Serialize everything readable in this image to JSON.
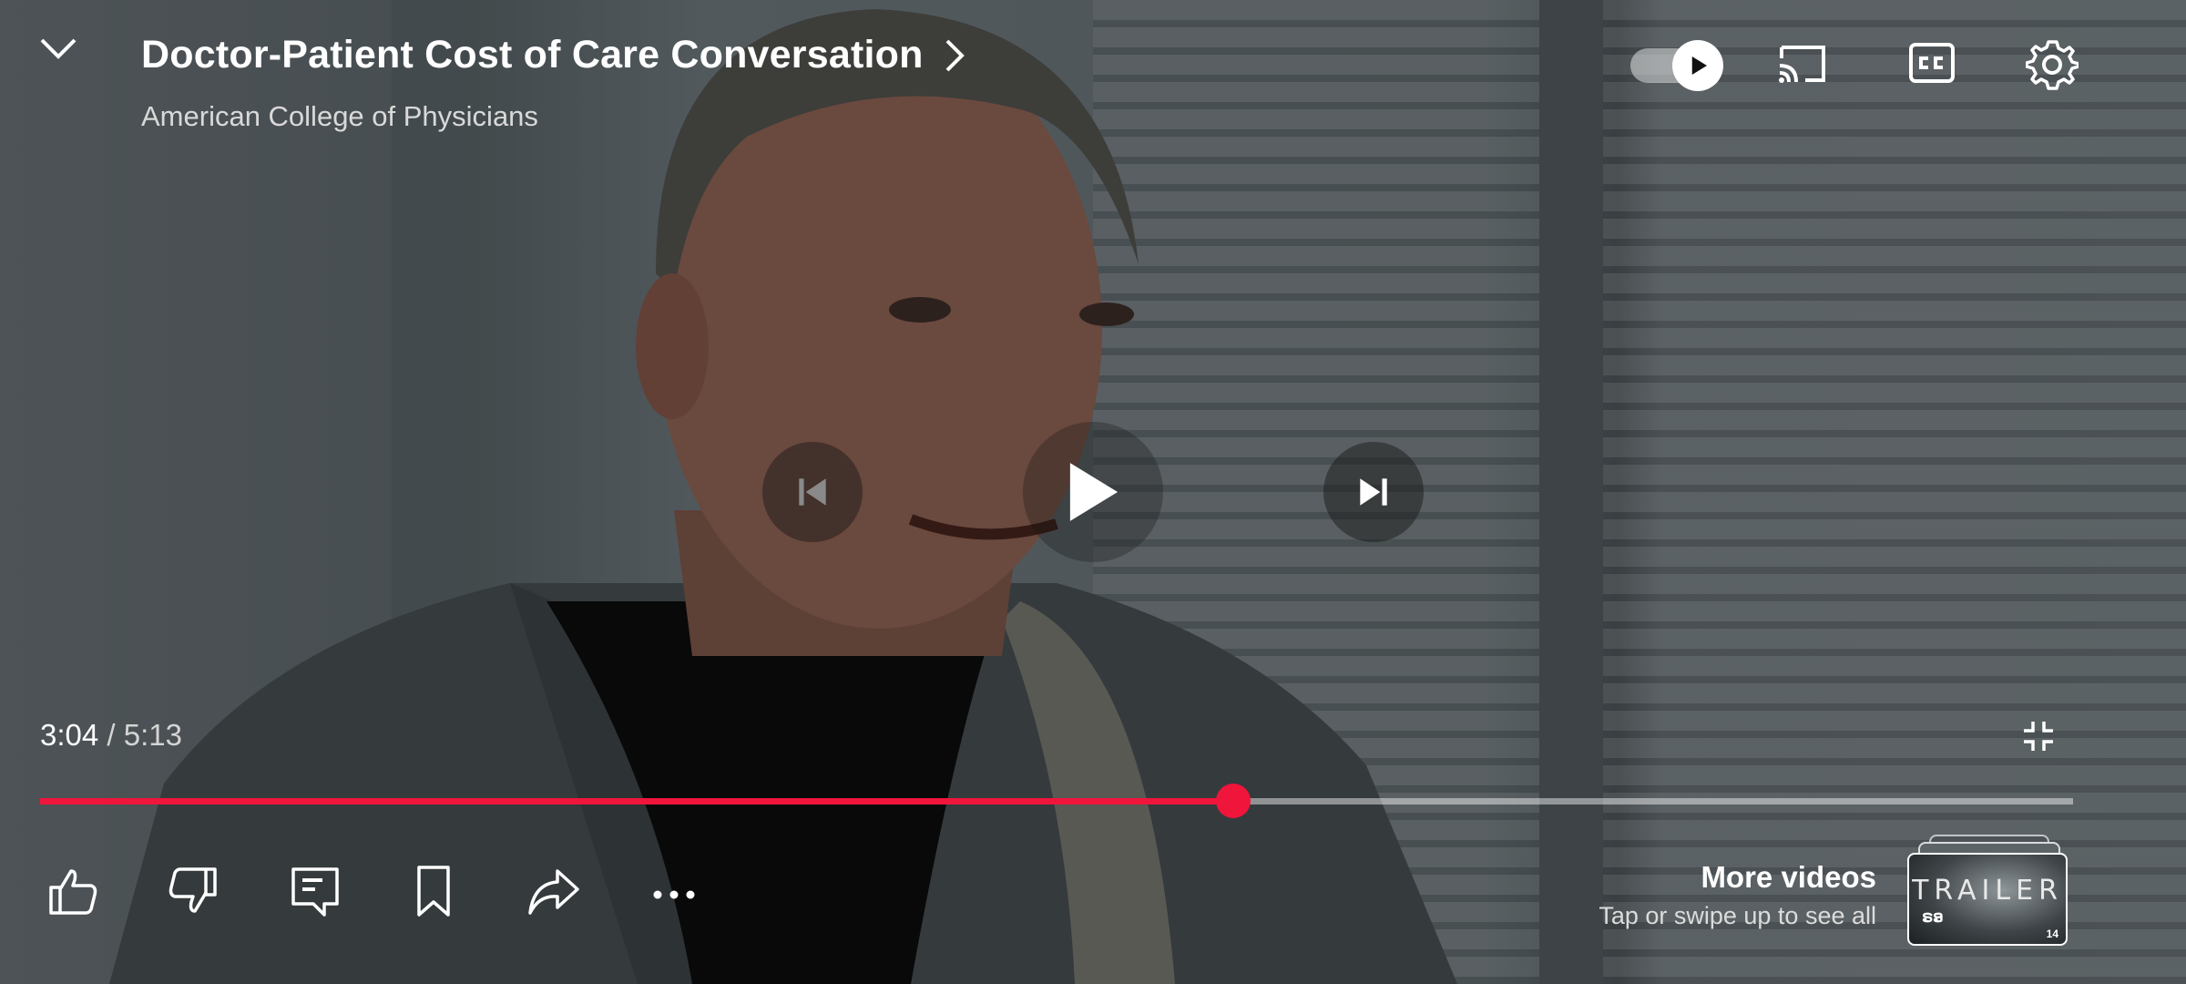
{
  "header": {
    "title": "Doctor-Patient Cost of Care Conversation",
    "channel": "American College of Physicians"
  },
  "player": {
    "current_time": "3:04",
    "separator": " / ",
    "duration": "5:13",
    "progress_fraction": 0.587
  },
  "more_videos": {
    "title": "More videos",
    "subtitle": "Tap or swipe up to see all",
    "thumbnail_text": "TRAILER",
    "thumbnail_small_text": "ຣອ",
    "thumbnail_badge": "14"
  },
  "colors": {
    "accent": "#f0153b"
  },
  "icons": {
    "collapse": "chevron-down-icon",
    "title_more": "chevron-right-icon",
    "autoplay": "autoplay-toggle-icon",
    "cast": "cast-icon",
    "captions": "closed-captions-icon",
    "settings": "gear-icon",
    "previous": "skip-previous-icon",
    "play": "play-icon",
    "next": "skip-next-icon",
    "exit_fullscreen": "exit-fullscreen-icon",
    "like": "thumbs-up-icon",
    "dislike": "thumbs-down-icon",
    "comments": "comment-icon",
    "save": "bookmark-icon",
    "share": "share-icon",
    "more": "more-horizontal-icon"
  }
}
